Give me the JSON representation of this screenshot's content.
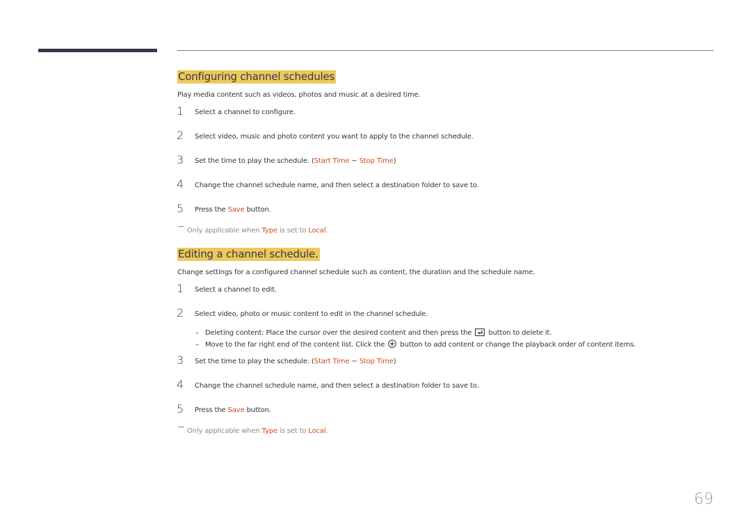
{
  "sections": [
    {
      "title": "Configuring channel schedules",
      "intro": "Play media content such as videos, photos and music at a desired time.",
      "steps": [
        {
          "num": "1",
          "text": "Select a channel to configure."
        },
        {
          "num": "2",
          "text": "Select video, music and photo content you want to apply to the channel schedule."
        },
        {
          "num": "3",
          "text_before": "Set the time to play the schedule. (",
          "hl1": "Start Time",
          "mid": " ~ ",
          "hl2": "Stop Time",
          "text_after": ")"
        },
        {
          "num": "4",
          "text": "Change the channel schedule name, and then select a destination folder to save to."
        },
        {
          "num": "5",
          "text_before": "Press the ",
          "hl1": "Save",
          "text_after": " button."
        }
      ],
      "note": {
        "before": "Only applicable when ",
        "hl1": "Type",
        "mid": " is set to ",
        "hl2": "Local",
        "after": "."
      }
    },
    {
      "title": "Editing a channel schedule.",
      "intro": "Change settings for a configured channel schedule such as content, the duration and the schedule name.",
      "steps": [
        {
          "num": "1",
          "text": "Select a channel to edit."
        },
        {
          "num": "2",
          "text": "Select video, photo or music content to edit in the channel schedule."
        },
        {
          "num": "3",
          "text_before": "Set the time to play the schedule. (",
          "hl1": "Start Time",
          "mid": " ~ ",
          "hl2": "Stop Time",
          "text_after": ")"
        },
        {
          "num": "4",
          "text": "Change the channel schedule name, and then select a destination folder to save to."
        },
        {
          "num": "5",
          "text_before": "Press the ",
          "hl1": "Save",
          "text_after": " button."
        }
      ],
      "sub_items": [
        {
          "dash": "–",
          "before": "Deleting content: Place the cursor over the desired content and then press the ",
          "icon": "delete-content-icon",
          "after": " button to delete it."
        },
        {
          "dash": "–",
          "before": "Move to the far right end of the content list. Click the ",
          "icon": "add-circle-icon",
          "after": " button to add content or change the playback order of content items."
        }
      ],
      "note": {
        "before": "Only applicable when ",
        "hl1": "Type",
        "mid": " is set to ",
        "hl2": "Local",
        "after": "."
      }
    }
  ],
  "page_number": "69",
  "colors": {
    "highlight_bg": "#ecc95a",
    "accent_text": "#d24a1e",
    "bar": "#3d3349"
  }
}
